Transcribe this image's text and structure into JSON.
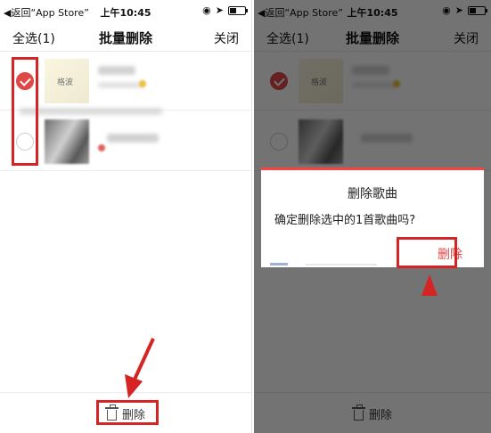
{
  "status_bar": {
    "back_label": "◀返回“App Store”",
    "time": "上午10:45"
  },
  "nav": {
    "select_all": "全选(1)",
    "title": "批量删除",
    "close": "关闭"
  },
  "songs": [
    {
      "cover_text": "格波",
      "checked": true
    },
    {
      "cover_text": "",
      "checked": false
    }
  ],
  "bottom_bar": {
    "delete_label": "删除"
  },
  "dialog": {
    "title": "删除歌曲",
    "message": "确定删除选中的1首歌曲吗?",
    "confirm_label": "删除"
  },
  "colors": {
    "accent": "#e04848",
    "highlight": "#d42424",
    "dialog_top_border": "#ff3e3e"
  },
  "icons": {
    "location": "location-icon",
    "navigation": "arrow-icon",
    "battery": "battery-icon",
    "delete": "trash-icon"
  }
}
